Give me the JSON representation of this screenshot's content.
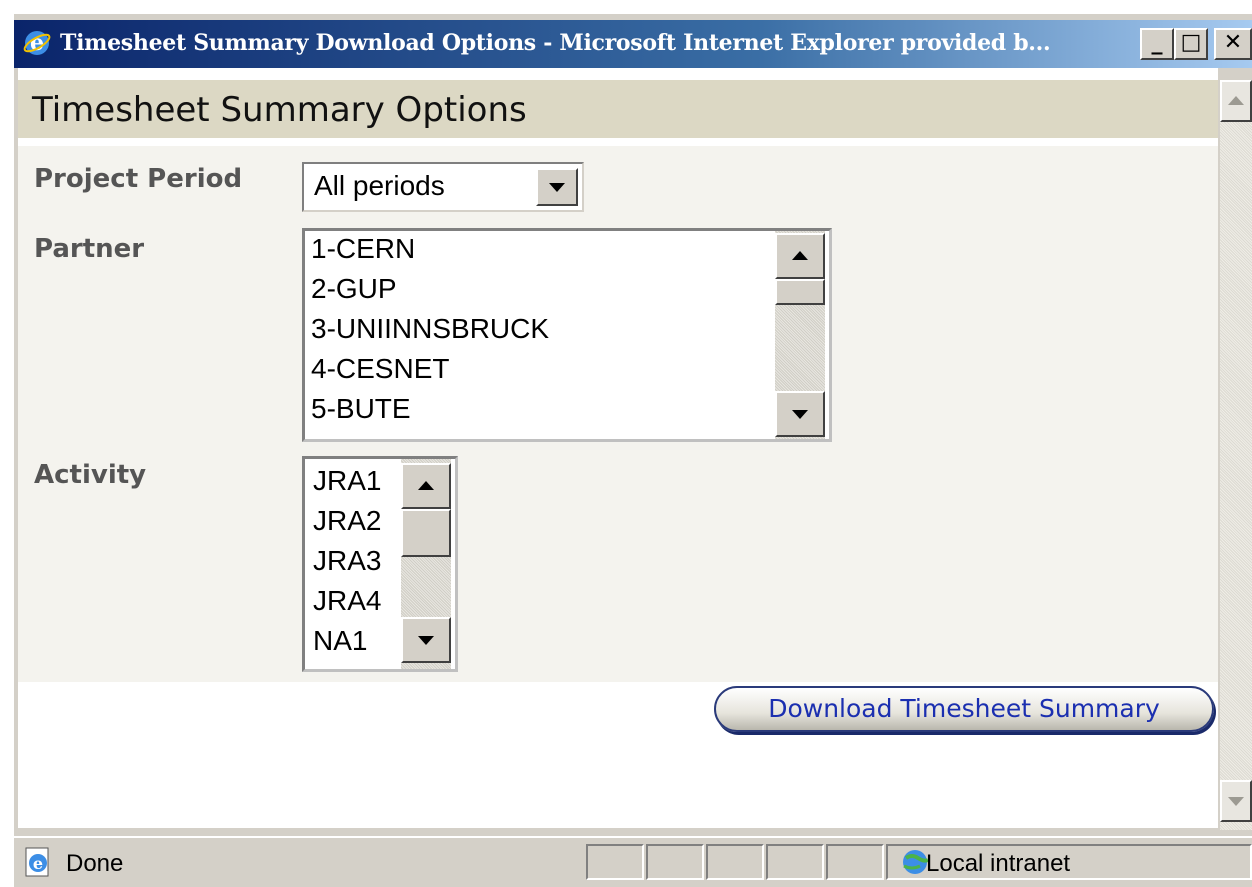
{
  "window": {
    "title": "Timesheet Summary Download Options - Microsoft Internet Explorer provided b...",
    "minimize_glyph": "_",
    "maximize_glyph": "□",
    "close_glyph": "✕"
  },
  "page": {
    "title": "Timesheet Summary Options"
  },
  "form": {
    "project_period": {
      "label": "Project Period",
      "selected": "All periods"
    },
    "partner": {
      "label": "Partner",
      "items": [
        "1-CERN",
        "2-GUP",
        "3-UNIINNSBRUCK",
        "4-CESNET",
        "5-BUTE"
      ]
    },
    "activity": {
      "label": "Activity",
      "items": [
        "JRA1",
        "JRA2",
        "JRA3",
        "JRA4",
        "NA1"
      ]
    },
    "download_label": "Download Timesheet Summary"
  },
  "statusbar": {
    "status": "Done",
    "zone": "Local intranet"
  },
  "colors": {
    "titlebar_start": "#0a246a",
    "header_band": "#dcd8c4",
    "form_band": "#f4f3ee",
    "link_blue": "#1b2fb0"
  },
  "icons": {
    "app": "ie-icon",
    "status": "ie-page-icon",
    "zone": "local-intranet-icon"
  }
}
